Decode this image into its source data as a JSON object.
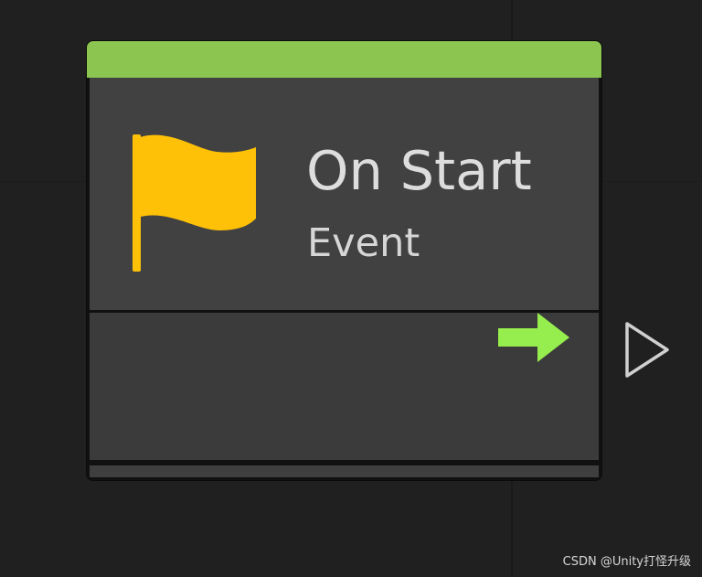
{
  "node": {
    "title": "On Start",
    "subtitle": "Event",
    "accent_color": "#8DC551",
    "icon": "flag-icon",
    "icon_color": "#FFC107",
    "output_icon": "right-arrow-icon",
    "output_color": "#96EE4E",
    "port_icon": "triangle-outline-icon"
  },
  "watermark": {
    "text": "CSDN @Unity打怪升级"
  }
}
